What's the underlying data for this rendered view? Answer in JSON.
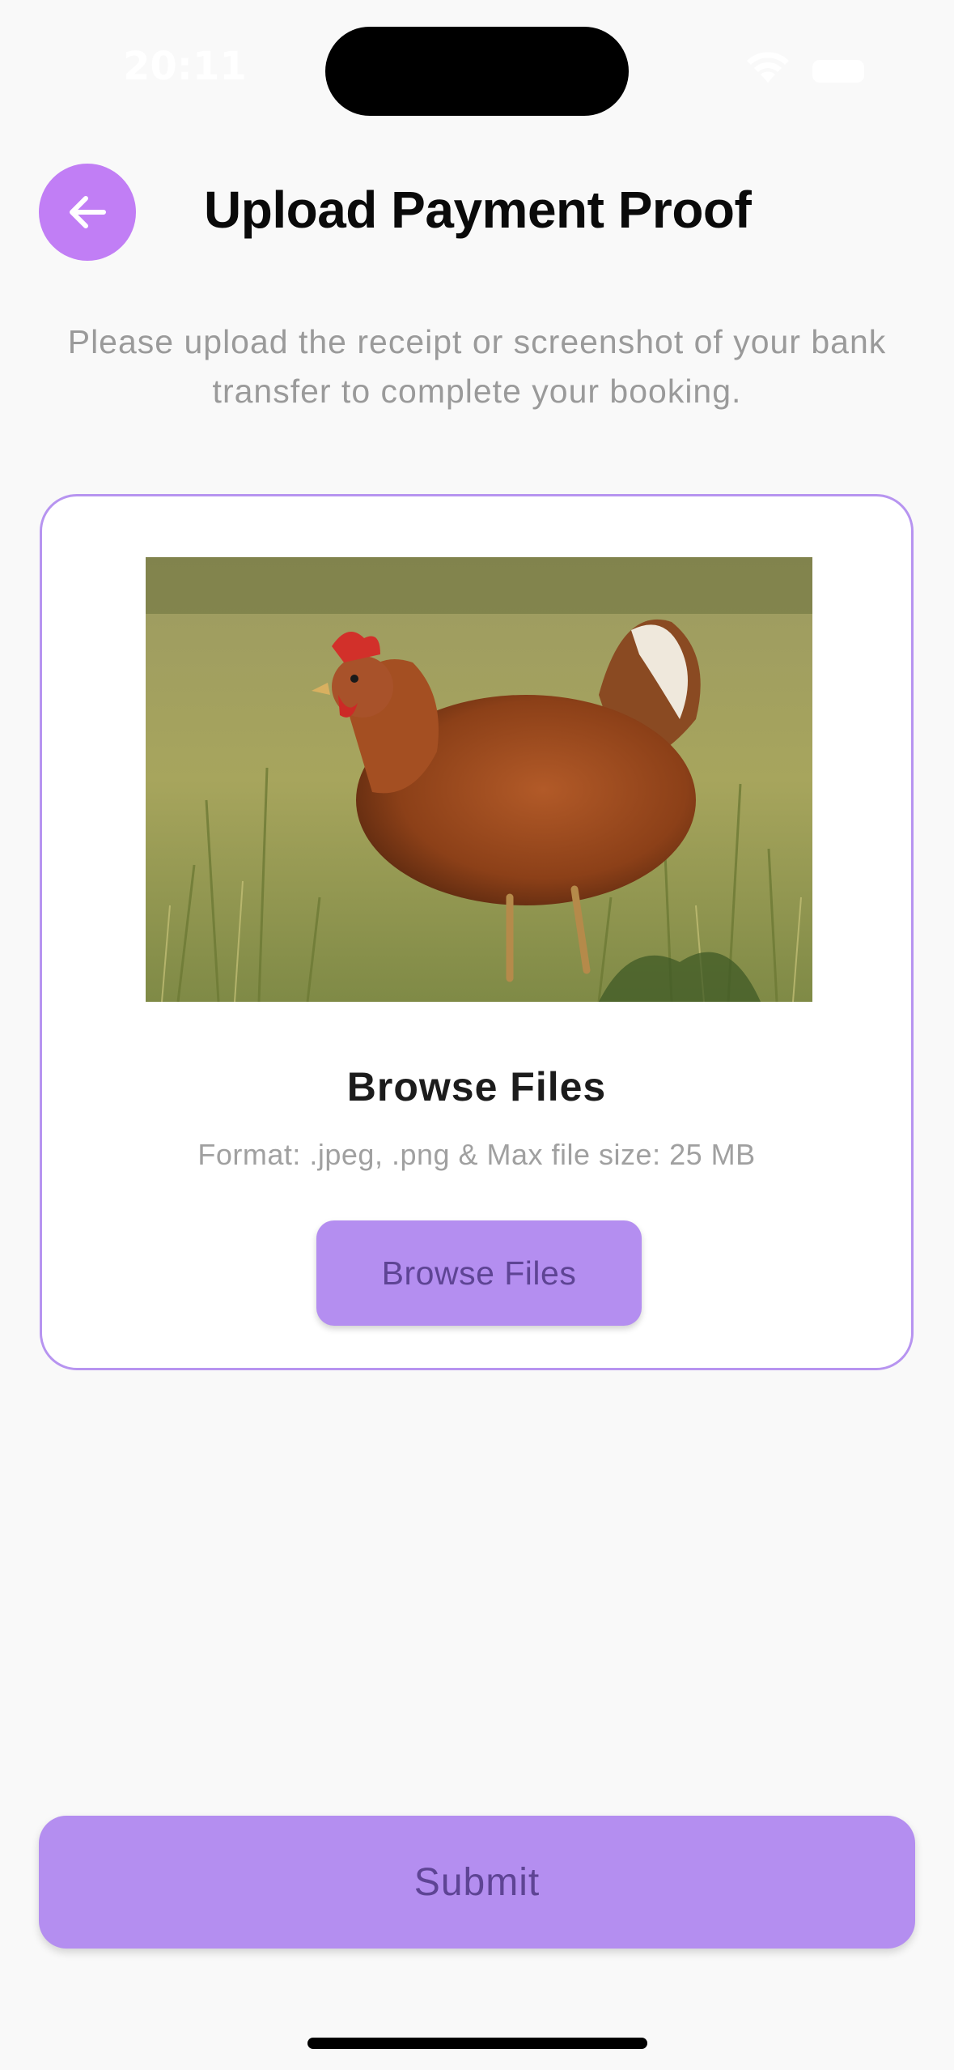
{
  "status_bar": {
    "time": "20:11",
    "icons": [
      "wifi-icon",
      "battery-icon"
    ]
  },
  "header": {
    "back_icon": "arrow-left-icon",
    "title": "Upload Payment Proof"
  },
  "subtitle": "Please upload the receipt or screenshot of your bank transfer to complete your booking.",
  "upload_card": {
    "preview_image": "chicken-photo",
    "title": "Browse Files",
    "format_text": "Format: .jpeg, .png & Max file size: 25 MB",
    "browse_button_label": "Browse Files"
  },
  "submit_label": "Submit",
  "colors": {
    "accent": "#c17ef5",
    "button": "#b48ef0",
    "button_text": "#5e4494",
    "card_border": "#b794f0",
    "background": "#f9f9f9"
  }
}
